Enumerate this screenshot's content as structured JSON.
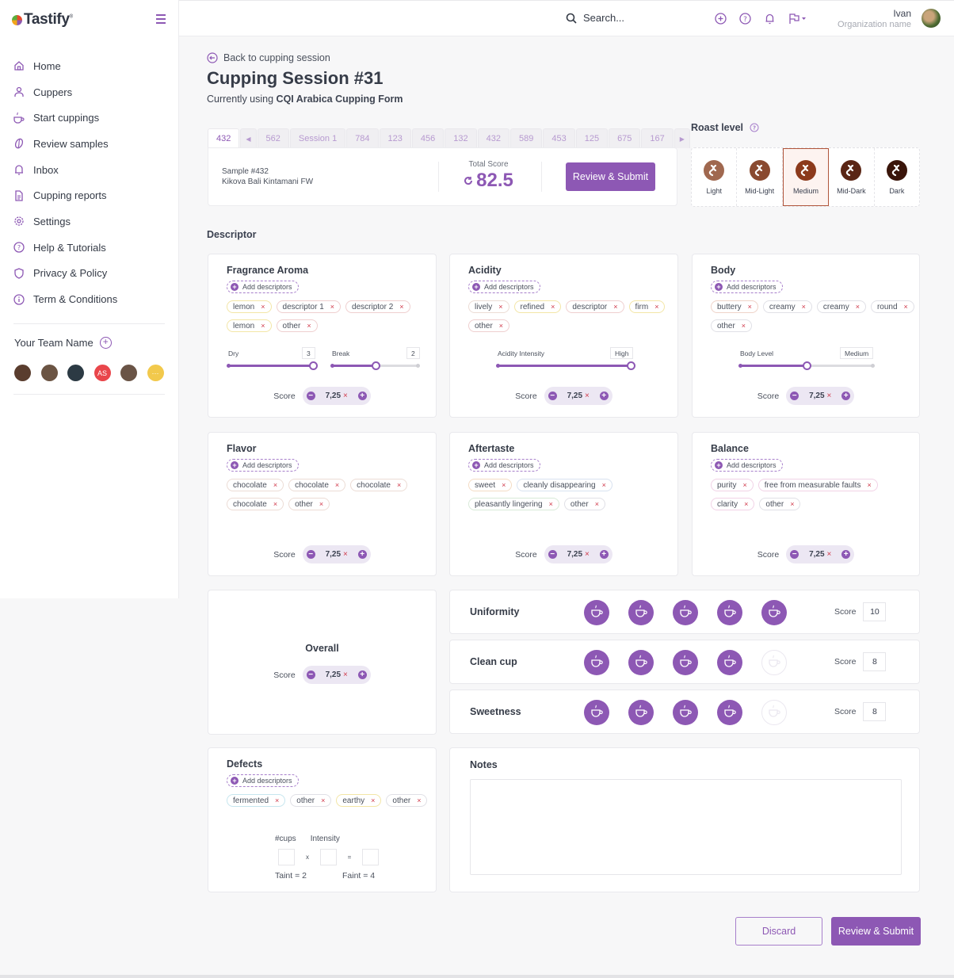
{
  "app": {
    "name": "Tastify"
  },
  "sidebar": {
    "items": [
      {
        "label": "Home",
        "icon": "home-icon"
      },
      {
        "label": "Cuppers",
        "icon": "user-icon"
      },
      {
        "label": "Start cuppings",
        "icon": "cup-icon"
      },
      {
        "label": "Review samples",
        "icon": "bean-icon"
      },
      {
        "label": "Inbox",
        "icon": "bell-icon"
      },
      {
        "label": "Cupping reports",
        "icon": "document-icon"
      },
      {
        "label": "Settings",
        "icon": "gear-icon"
      },
      {
        "label": "Help & Tutorials",
        "icon": "question-icon"
      },
      {
        "label": "Privacy & Policy",
        "icon": "shield-icon"
      },
      {
        "label": "Term & Conditions",
        "icon": "info-icon"
      }
    ],
    "team": {
      "name": "Your Team Name",
      "members": [
        {
          "initials": "",
          "color": "#5a3d2e"
        },
        {
          "initials": "",
          "color": "#6b5443"
        },
        {
          "initials": "",
          "color": "#2c3a44"
        },
        {
          "initials": "AS",
          "color": "#e9464b"
        },
        {
          "initials": "",
          "color": "#6a5446"
        },
        {
          "initials": "···",
          "color": "#f2c94c"
        }
      ]
    }
  },
  "topbar": {
    "search_placeholder": "Search...",
    "user_name": "Ivan",
    "org_name": "Organization name"
  },
  "header": {
    "back_label": "Back to cupping session",
    "title": "Cupping Session #31",
    "subtitle_prefix": "Currently using ",
    "form_name": "CQI Arabica Cupping Form"
  },
  "tabs": [
    "432",
    "562",
    "Session 1",
    "784",
    "123",
    "456",
    "132",
    "432",
    "589",
    "453",
    "125",
    "675",
    "167"
  ],
  "active_tab": 0,
  "sample": {
    "id_label": "Sample #432",
    "name": "Kikova Bali Kintamani FW",
    "total_score_label": "Total Score",
    "total_score": "82.5",
    "submit_label": "Review & Submit"
  },
  "roast": {
    "title": "Roast level",
    "options": [
      {
        "label": "Light",
        "color": "#a0684f"
      },
      {
        "label": "Mid-Light",
        "color": "#8a4a30"
      },
      {
        "label": "Medium",
        "color": "#8c3a1c"
      },
      {
        "label": "Mid-Dark",
        "color": "#5a2514"
      },
      {
        "label": "Dark",
        "color": "#3a150a"
      }
    ],
    "selected": "Medium"
  },
  "descriptor": {
    "title": "Descriptor",
    "add_label": "Add descriptors",
    "score_label": "Score",
    "cards": [
      {
        "title": "Fragrance Aroma",
        "chips": [
          {
            "label": "lemon",
            "color": "#f3e6a6"
          },
          {
            "label": "descriptor 1",
            "color": "#efcfcf"
          },
          {
            "label": "descriptor 2",
            "color": "#efcfcf"
          },
          {
            "label": "lemon",
            "color": "#f3e6a6"
          },
          {
            "label": "other",
            "color": "#efcfcf"
          }
        ],
        "sliders": [
          {
            "label": "Dry",
            "value": "3",
            "fraction": 1.0
          },
          {
            "label": "Break",
            "value": "2",
            "fraction": 0.5
          }
        ],
        "score": "7,25"
      },
      {
        "title": "Acidity",
        "chips": [
          {
            "label": "lively",
            "color": "#ecdcd5"
          },
          {
            "label": "refined",
            "color": "#f3e6a6"
          },
          {
            "label": "descriptor",
            "color": "#efcfcf"
          },
          {
            "label": "firm",
            "color": "#f3e6a6"
          },
          {
            "label": "other",
            "color": "#efcfcf"
          }
        ],
        "sliders": [
          {
            "label": "Acidity Intensity",
            "value": "High",
            "fraction": 1.0
          }
        ],
        "score": "7,25"
      },
      {
        "title": "Body",
        "chips": [
          {
            "label": "buttery",
            "color": "#efd3c8"
          },
          {
            "label": "creamy",
            "color": "#e0e0e6"
          },
          {
            "label": "creamy",
            "color": "#e0e0e6"
          },
          {
            "label": "round",
            "color": "#e0e0e6"
          },
          {
            "label": "other",
            "color": "#e0e0e6"
          }
        ],
        "sliders": [
          {
            "label": "Body Level",
            "value": "Medium",
            "fraction": 0.5
          }
        ],
        "score": "7,25"
      },
      {
        "title": "Flavor",
        "chips": [
          {
            "label": "chocolate",
            "color": "#ecdcd5"
          },
          {
            "label": "chocolate",
            "color": "#ecdcd5"
          },
          {
            "label": "chocolate",
            "color": "#ecdcd5"
          },
          {
            "label": "chocolate",
            "color": "#ecdcd5"
          },
          {
            "label": "other",
            "color": "#ecdcd5"
          }
        ],
        "sliders": [],
        "score": "7,25"
      },
      {
        "title": "Aftertaste",
        "chips": [
          {
            "label": "sweet",
            "color": "#f4dcc4"
          },
          {
            "label": "cleanly disappearing",
            "color": "#d8e2f0"
          },
          {
            "label": "pleasantly lingering",
            "color": "#d8ead8"
          },
          {
            "label": "other",
            "color": "#e0e0e6"
          }
        ],
        "sliders": [],
        "score": "7,25"
      },
      {
        "title": "Balance",
        "chips": [
          {
            "label": "purity",
            "color": "#f1d2e6"
          },
          {
            "label": "free from measurable faults",
            "color": "#f1d2e6"
          },
          {
            "label": "clarity",
            "color": "#f1d2e6"
          },
          {
            "label": "other",
            "color": "#e0e0e6"
          }
        ],
        "sliders": [],
        "score": "7,25"
      }
    ]
  },
  "overall": {
    "title": "Overall",
    "score_label": "Score",
    "score": "7,25"
  },
  "cup_rows": [
    {
      "name": "Uniformity",
      "filled": 5,
      "total": 5,
      "score": "10"
    },
    {
      "name": "Clean cup",
      "filled": 4,
      "total": 5,
      "score": "8"
    },
    {
      "name": "Sweetness",
      "filled": 4,
      "total": 5,
      "score": "8"
    }
  ],
  "cup_score_label": "Score",
  "defects": {
    "title": "Defects",
    "add_label": "Add descriptors",
    "chips": [
      {
        "label": "fermented",
        "color": "#c6e6ef"
      },
      {
        "label": "other",
        "color": "#e0e0e6"
      },
      {
        "label": "earthy",
        "color": "#f3e6a6"
      },
      {
        "label": "other",
        "color": "#e0e0e6"
      }
    ],
    "cups_label": "#cups",
    "intensity_label": "Intensity",
    "times": "x",
    "equals": "=",
    "taint_note": "Taint = 2",
    "faint_note": "Faint = 4"
  },
  "notes": {
    "title": "Notes",
    "value": ""
  },
  "footer": {
    "discard_label": "Discard",
    "submit_label": "Review & Submit"
  }
}
